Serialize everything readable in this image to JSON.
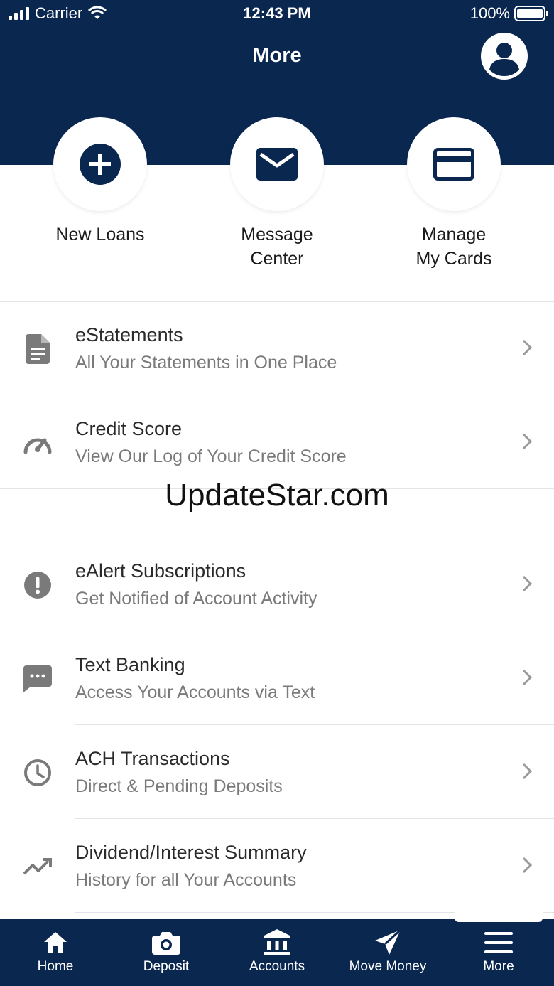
{
  "status_bar": {
    "carrier": "Carrier",
    "time": "12:43 PM",
    "battery": "100%"
  },
  "header": {
    "title": "More"
  },
  "quick_actions": [
    {
      "line1": "New Loans",
      "line2": ""
    },
    {
      "line1": "Message",
      "line2": "Center"
    },
    {
      "line1": "Manage",
      "line2": "My Cards"
    }
  ],
  "menu": [
    {
      "title": "eStatements",
      "subtitle": "All Your Statements in One Place",
      "icon": "document-icon"
    },
    {
      "title": "Credit Score",
      "subtitle": "View Our Log of Your Credit Score",
      "icon": "speedometer-icon"
    },
    {
      "title": "eAlert Subscriptions",
      "subtitle": "Get Notified of Account Activity",
      "icon": "alert-icon"
    },
    {
      "title": "Text Banking",
      "subtitle": "Access Your Accounts via Text",
      "icon": "chat-icon"
    },
    {
      "title": "ACH Transactions",
      "subtitle": "Direct & Pending Deposits",
      "icon": "clock-icon"
    },
    {
      "title": "Dividend/Interest Summary",
      "subtitle": "History for all Your Accounts",
      "icon": "trending-up-icon"
    }
  ],
  "watermark": "UpdateStar.com",
  "tabs": [
    {
      "label": "Home",
      "icon": "home-icon"
    },
    {
      "label": "Deposit",
      "icon": "camera-icon"
    },
    {
      "label": "Accounts",
      "icon": "bank-icon"
    },
    {
      "label": "Move Money",
      "icon": "send-icon"
    },
    {
      "label": "More",
      "icon": "menu-icon"
    }
  ],
  "colors": {
    "brand_navy": "#0a2750",
    "icon_gray": "#7a7a7a",
    "text_dark": "#2a2a2a"
  }
}
